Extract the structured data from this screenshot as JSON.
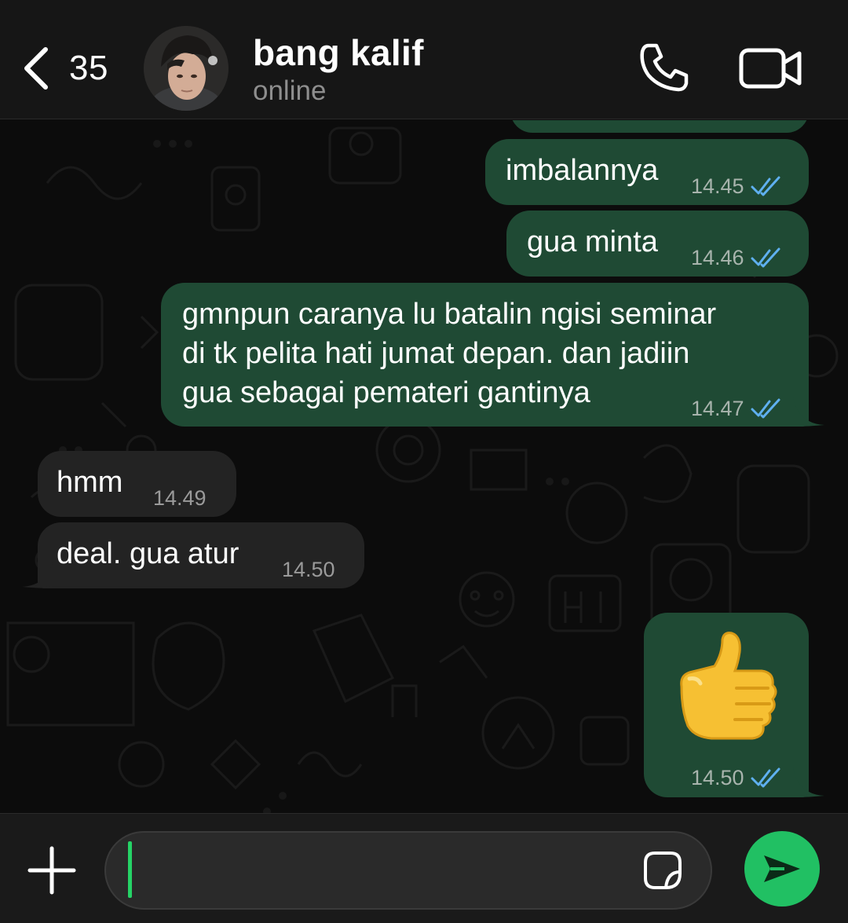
{
  "header": {
    "back_count": "35",
    "contact_name": "bang kalif",
    "contact_status": "online"
  },
  "messages": [
    {
      "direction": "out",
      "text": "imbalannya",
      "time": "14.45",
      "status": "read"
    },
    {
      "direction": "out",
      "text": "gua minta",
      "time": "14.46",
      "status": "read"
    },
    {
      "direction": "out",
      "lines": [
        "gmnpun caranya lu batalin ngisi seminar",
        "di tk pelita hati jumat depan. dan jadiin",
        "gua sebagai pemateri gantinya"
      ],
      "time": "14.47",
      "status": "read"
    },
    {
      "direction": "in",
      "text": "hmm",
      "time": "14.49"
    },
    {
      "direction": "in",
      "text": "deal. gua atur",
      "time": "14.50"
    },
    {
      "direction": "out",
      "emoji": "thumbs-up",
      "time": "14.50",
      "status": "read"
    }
  ],
  "composer": {
    "value": "",
    "placeholder": ""
  },
  "colors": {
    "outgoing_bubble": "#1f4a34",
    "incoming_bubble": "#232323",
    "read_ticks": "#5fb0f0",
    "send_button": "#21c063",
    "caret": "#25d366"
  },
  "icons": [
    "back-chevron-icon",
    "phone-icon",
    "video-camera-icon",
    "plus-icon",
    "sticker-icon",
    "send-icon",
    "double-check-icon",
    "thumbs-up-emoji"
  ]
}
